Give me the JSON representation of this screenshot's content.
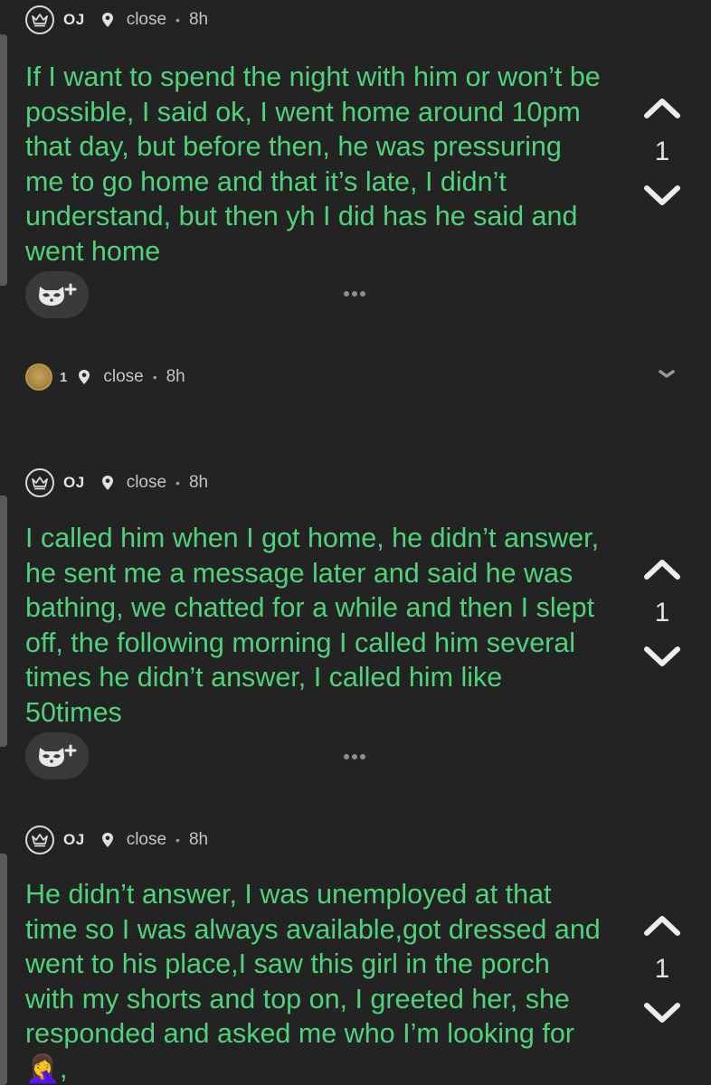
{
  "posts": [
    {
      "author": "OJ",
      "location": "close",
      "separator": "•",
      "time": "8h",
      "body": "If I want to spend the night with him or won’t be possible, I said ok, I went home around 10pm that day, but before then, he was pressuring me to go home and that it’s late, I didn’t understand, but then yh I did has he said and went home",
      "votes": "1"
    },
    {
      "author": "OJ",
      "location": "close",
      "separator": "•",
      "time": "8h",
      "body": "I called him when I got home, he didn’t answer, he sent me a message later and said he was bathing, we chatted for a while and then I slept off, the following morning I called him several times he didn’t answer, I called him like 50times",
      "votes": "1"
    },
    {
      "author": "OJ",
      "location": "close",
      "separator": "•",
      "time": "8h",
      "body": "He didn’t answer, I was unemployed at that time so I was always available,got dressed and went to his place,I saw this girl in the porch with my shorts and top on, I greeted her, she responded and asked me who I’m looking for 🤦‍♀️,",
      "votes": "1"
    }
  ],
  "collapsed_reply": {
    "count": "1",
    "location": "close",
    "separator": "•",
    "time": "8h"
  },
  "icons": {
    "badge": "crown-icon",
    "location": "location-pin-icon",
    "upvote": "chevron-up-icon",
    "downvote": "chevron-down-icon",
    "react": "raccoon-plus-icon",
    "more": "more-dots-icon",
    "expand": "expand-chevron-icon"
  },
  "colors": {
    "background": "#232324",
    "body_text": "#4fd27a",
    "meta_text": "#c4c4c4",
    "thread_bar": "#5a5a5c",
    "button_bg": "#3a3a3c"
  }
}
